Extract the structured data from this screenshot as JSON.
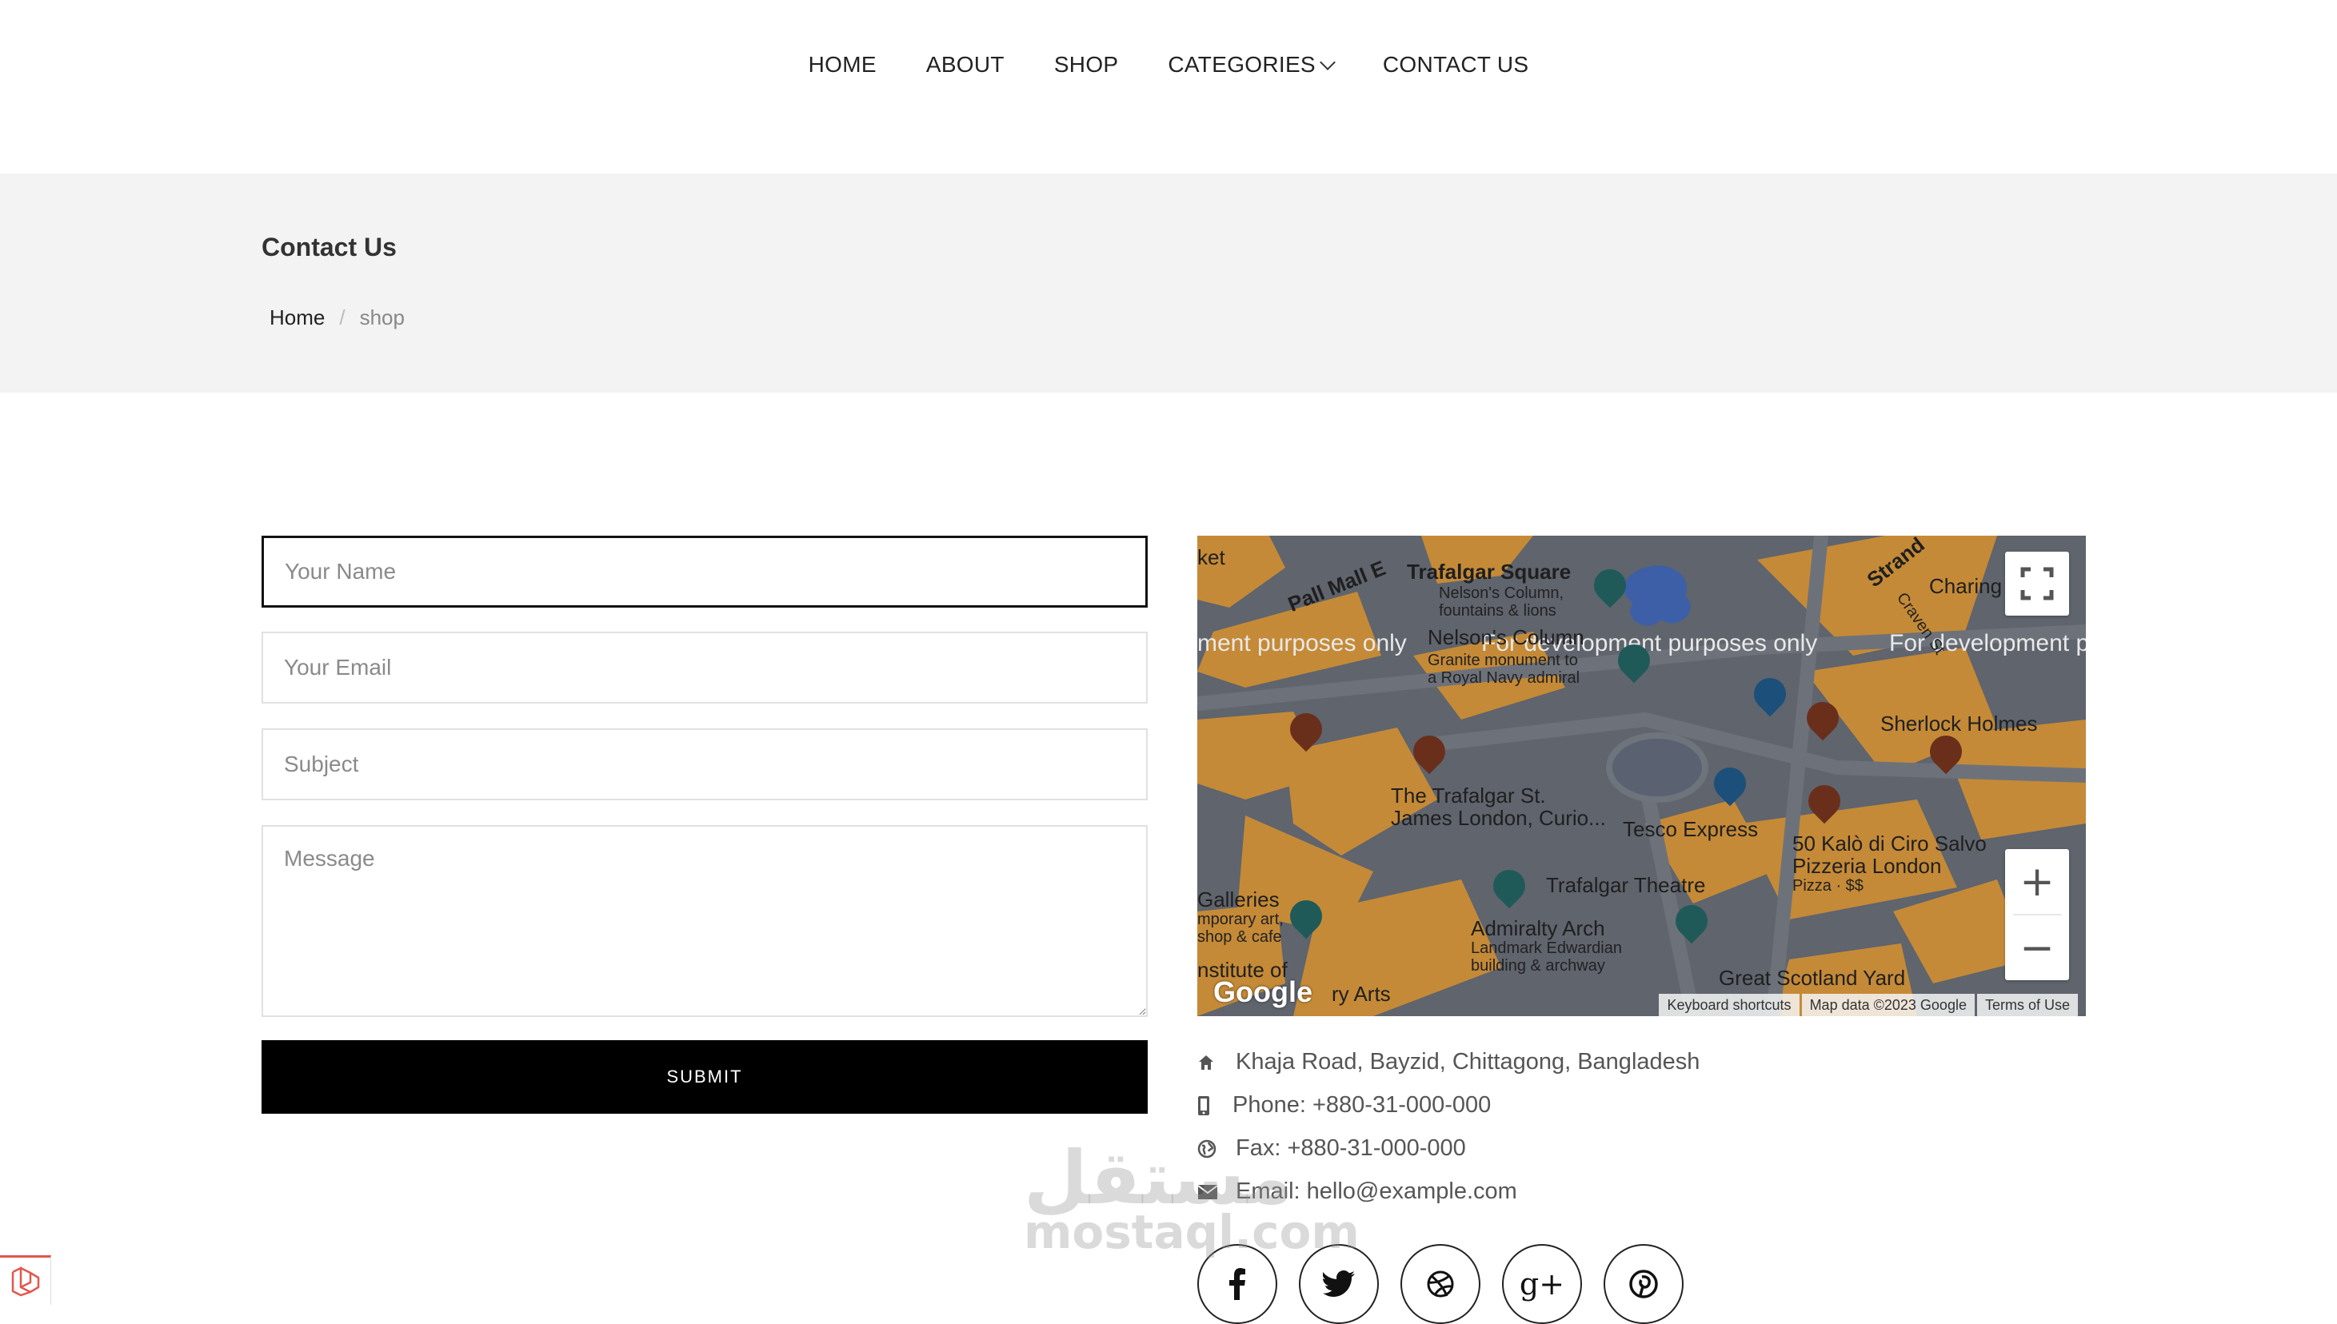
{
  "nav": {
    "items": [
      "HOME",
      "ABOUT",
      "SHOP",
      "CATEGORIES",
      "CONTACT US"
    ]
  },
  "header": {
    "title": "Contact Us",
    "breadcrumb": {
      "home": "Home",
      "current": "shop"
    }
  },
  "form": {
    "name_placeholder": "Your Name",
    "email_placeholder": "Your Email",
    "subject_placeholder": "Subject",
    "message_placeholder": "Message",
    "submit_label": "SUBMIT"
  },
  "map": {
    "dev_text": "For development purposes only",
    "dev_text_left": "ment purposes only",
    "dev_text_right": "For development p",
    "labels": {
      "trafalgar_square": "Trafalgar Square",
      "trafalgar_sub1": "Nelson's Column,",
      "trafalgar_sub2": "fountains & lions",
      "nelsons_column": "Nelson's Column",
      "nelsons_sub1": "Granite monument to",
      "nelsons_sub2": "a Royal Navy admiral",
      "pall_mall": "Pall Mall E",
      "strand": "Strand",
      "charing": "Charing",
      "craven": "Craven St",
      "sherlock": "Sherlock Holmes",
      "trafalgar_st_james_1": "The Trafalgar St.",
      "trafalgar_st_james_2": "James London, Curio...",
      "tesco": "Tesco Express",
      "kalo_1": "50 Kalò di Ciro Salvo",
      "kalo_2": "Pizzeria London",
      "kalo_3": "Pizza · $$",
      "galleries_1": "Galleries",
      "galleries_2": "mporary art,",
      "galleries_3": "shop & cafe",
      "trafalgar_theatre": "Trafalgar Theatre",
      "admiralty": "Admiralty Arch",
      "admiralty_sub1": "Landmark Edwardian",
      "admiralty_sub2": "building & archway",
      "institute": "nstitute of",
      "ry_arts": "ry Arts",
      "great_scotland": "Great Scotland Yard",
      "ket": "ket",
      "google": "Google"
    },
    "attribution": [
      "Keyboard shortcuts",
      "Map data ©2023 Google",
      "Terms of Use"
    ],
    "colors": {
      "water": "#3d5fa8",
      "building": "#c58a37",
      "road": "#5f646d"
    }
  },
  "contact": {
    "address": "Khaja Road, Bayzid, Chittagong, Bangladesh",
    "phone": "Phone: +880-31-000-000",
    "fax": "Fax: +880-31-000-000",
    "email": "Email: hello@example.com"
  },
  "social": [
    "facebook-icon",
    "twitter-icon",
    "dribbble-icon",
    "google-plus-icon",
    "pinterest-icon"
  ],
  "social_text": {
    "google_plus": "g+"
  },
  "watermark": {
    "arabic": "مستقل",
    "latin": "mostaql.com"
  },
  "theme": {
    "accent": "#000000",
    "band": "#f3f3f3",
    "text": "#222222"
  }
}
